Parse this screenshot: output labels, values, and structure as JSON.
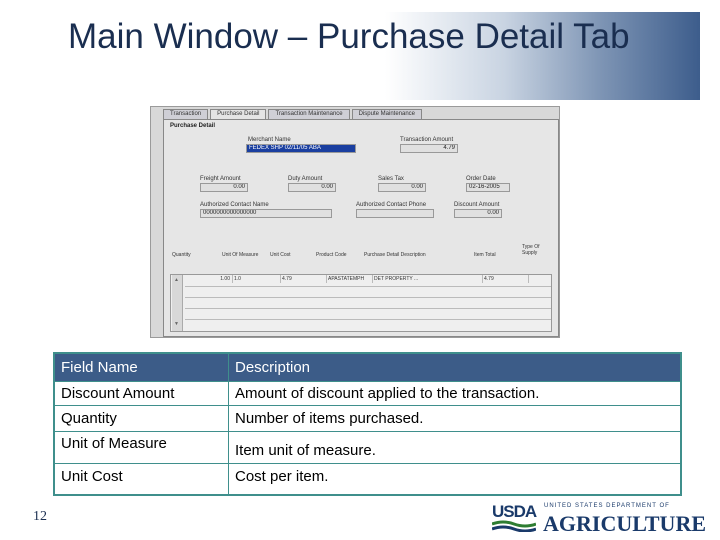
{
  "slide": {
    "title": "Main Window – Purchase Detail Tab",
    "page_number": "12"
  },
  "screen": {
    "tabs": [
      "Transaction",
      "Purchase Detail",
      "Transaction Maintenance",
      "Dispute Maintenance"
    ],
    "active_tab": "Purchase Detail",
    "panel_title": "Purchase Detail",
    "fields": {
      "merchant_name_label": "Merchant Name",
      "merchant_name_value": "FEDEX SHP 02/11/05 ABA",
      "transaction_amount_label": "Transaction Amount",
      "transaction_amount_value": "4.79",
      "freight_amount_label": "Freight Amount",
      "freight_amount_value": "0.00",
      "duty_amount_label": "Duty Amount",
      "duty_amount_value": "0.00",
      "sales_tax_label": "Sales Tax",
      "sales_tax_value": "0.00",
      "order_date_label": "Order Date",
      "order_date_value": "02-16-2005",
      "authorized_contact_name_label": "Authorized Contact Name",
      "authorized_contact_name_value": "0000000000000000",
      "authorized_contact_phone_label": "Authorized Contact Phone",
      "discount_amount_label": "Discount Amount",
      "discount_amount_value": "0.00"
    },
    "grid": {
      "headers": [
        "Quantity",
        "Unit Of Measure",
        "Unit Cost",
        "Product Code",
        "Purchase Detail Description",
        "Item Total",
        "Type Of Supply"
      ],
      "row": [
        "1.00",
        "1.0",
        "4.79",
        "APASTATEMPH",
        "DET PROPERTY ...",
        "4.79",
        ""
      ]
    }
  },
  "field_table": {
    "headers": [
      "Field Name",
      "Description"
    ],
    "rows": [
      [
        "Discount Amount",
        "Amount of discount applied to the transaction."
      ],
      [
        "Quantity",
        "Number of items purchased."
      ],
      [
        "Unit of Measure",
        "Item unit of measure."
      ],
      [
        "Unit Cost",
        "Cost per item."
      ]
    ]
  },
  "logo": {
    "mark": "USDA",
    "dept": "UNITED STATES DEPARTMENT OF",
    "agency": "AGRICULTURE"
  },
  "colors": {
    "table_border": "#3f8f8c",
    "table_header_bg": "#3c5c88",
    "title_text": "#1a2e50",
    "selected_field": "#1a3fa0"
  }
}
